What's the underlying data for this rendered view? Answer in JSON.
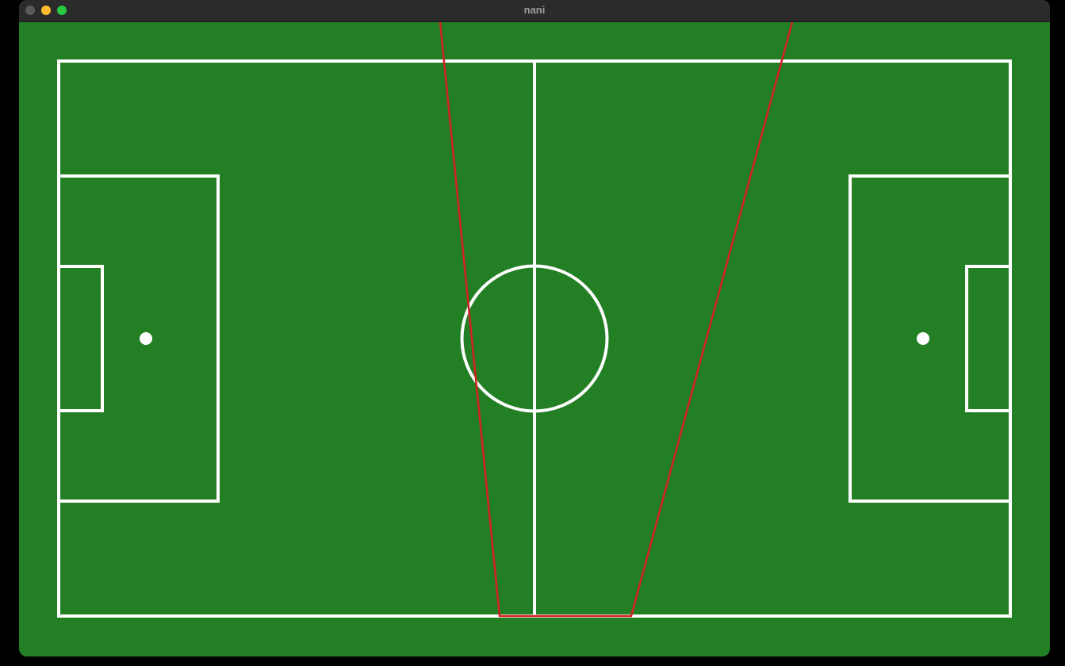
{
  "window": {
    "title": "nani"
  },
  "pitch": {
    "grass_color": "#237f24",
    "line_color": "#ffffff",
    "view_line_color": "#d42020",
    "elements": [
      "outer-boundary",
      "halfway-line",
      "center-circle",
      "left-penalty-area",
      "left-goal-area",
      "left-penalty-spot",
      "right-penalty-area",
      "right-goal-area",
      "right-penalty-spot",
      "camera-view-trapezoid"
    ]
  }
}
